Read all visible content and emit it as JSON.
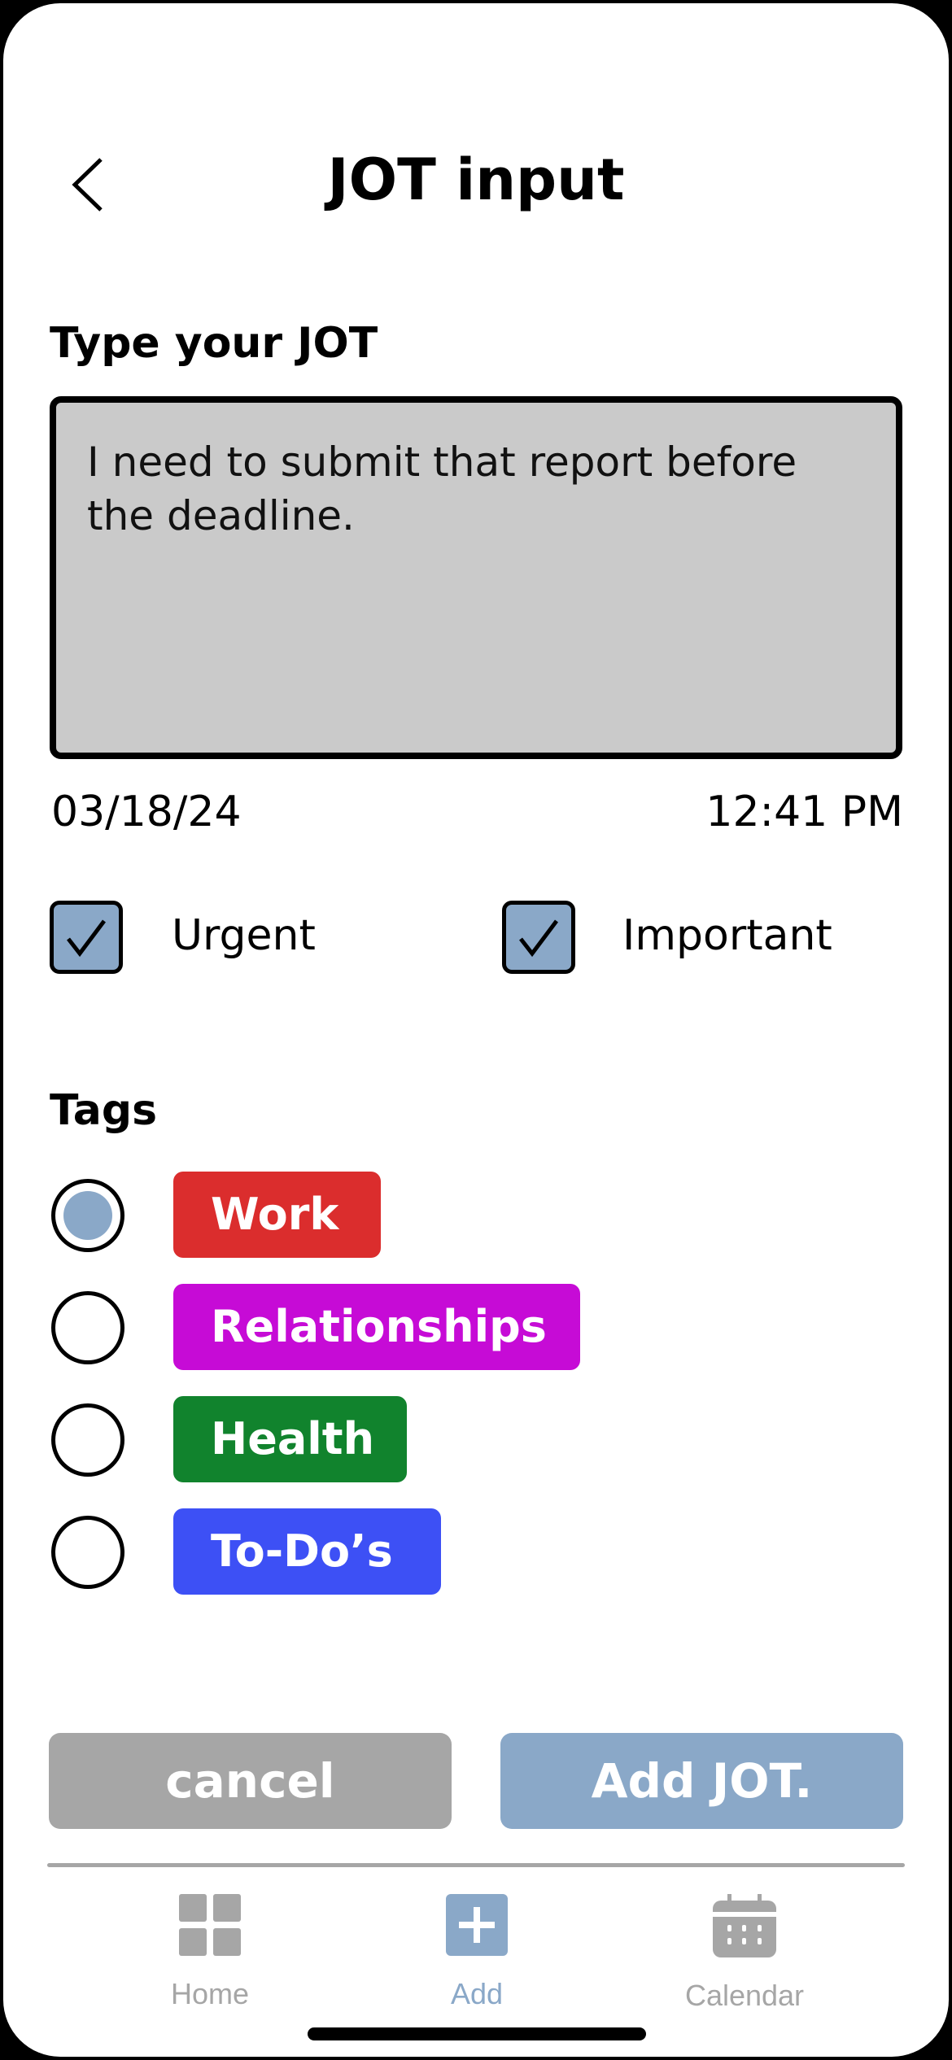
{
  "header": {
    "title": "JOT input",
    "back_icon": "chevron-left-icon"
  },
  "jot": {
    "label": "Type your JOT",
    "text": "I need to submit that report before the deadline.",
    "date": "03/18/24",
    "time": "12:41 PM"
  },
  "flags": [
    {
      "label": "Urgent",
      "checked": true
    },
    {
      "label": "Important",
      "checked": true
    }
  ],
  "tags": {
    "label": "Tags",
    "items": [
      {
        "label": "Work",
        "color": "#db2d2d",
        "selected": true
      },
      {
        "label": "Relationships",
        "color": "#c60bd6",
        "selected": false
      },
      {
        "label": "Health",
        "color": "#11832d",
        "selected": false
      },
      {
        "label": "To-Do’s",
        "color": "#3d50f5",
        "selected": false
      }
    ]
  },
  "actions": {
    "cancel": "cancel",
    "add": "Add JOT."
  },
  "colors": {
    "accent": "#8aa8c8",
    "muted": "#a6a6a6",
    "field": "#cacaca"
  },
  "nav": {
    "items": [
      {
        "label": "Home",
        "icon": "grid-icon",
        "active": false
      },
      {
        "label": "Add",
        "icon": "plus-square-icon",
        "active": true
      },
      {
        "label": "Calendar",
        "icon": "calendar-icon",
        "active": false
      }
    ]
  }
}
